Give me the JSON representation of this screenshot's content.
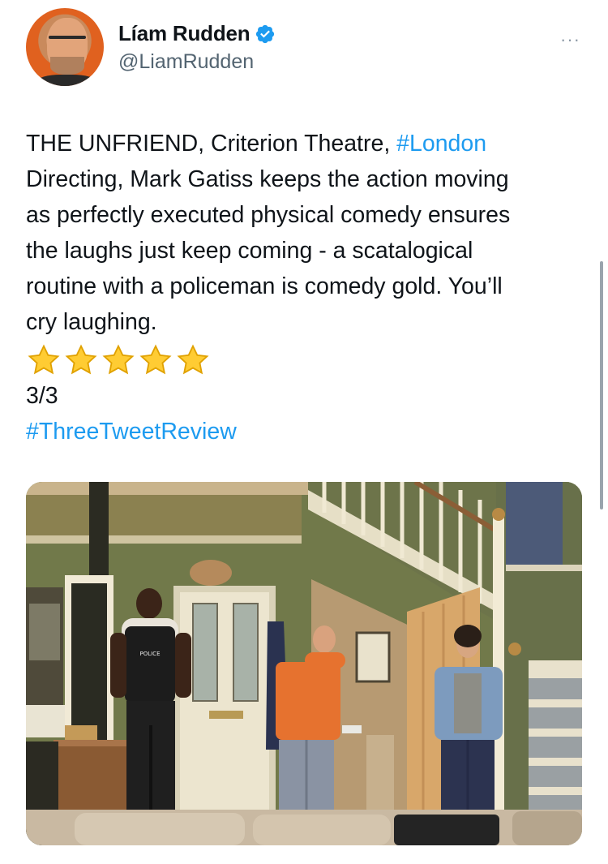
{
  "author": {
    "name": "Líam Rudden",
    "handle": "@LiamRudden",
    "verified": true,
    "avatar_icon": "profile-photo"
  },
  "more_menu": {
    "label": "···",
    "icon": "more-dots-icon"
  },
  "tweet": {
    "lines": [
      [
        {
          "text": "THE UNFRIEND, Criterion Theatre, "
        },
        {
          "text": "#London",
          "hashtag": true
        }
      ],
      [
        {
          "text": "Directing, Mark Gatiss keeps the action moving"
        }
      ],
      [
        {
          "text": "as perfectly executed physical comedy ensures"
        }
      ],
      [
        {
          "text": "the laughs just keep coming - a scatalogical"
        }
      ],
      [
        {
          "text": "routine with a policeman is comedy gold. You’ll"
        }
      ],
      [
        {
          "text": "cry laughing."
        }
      ]
    ],
    "rating": 5,
    "thread_count": "3/3",
    "closing_hashtag": "#ThreeTweetReview"
  },
  "media": {
    "photo_subject": "stage-scene-photo",
    "police_vest_text": "POLICE"
  },
  "colors": {
    "link": "#1d9bf0",
    "text": "#0f1419",
    "secondary": "#536471",
    "verified_badge": "#1d9bf0",
    "star": "#ffcc33"
  }
}
